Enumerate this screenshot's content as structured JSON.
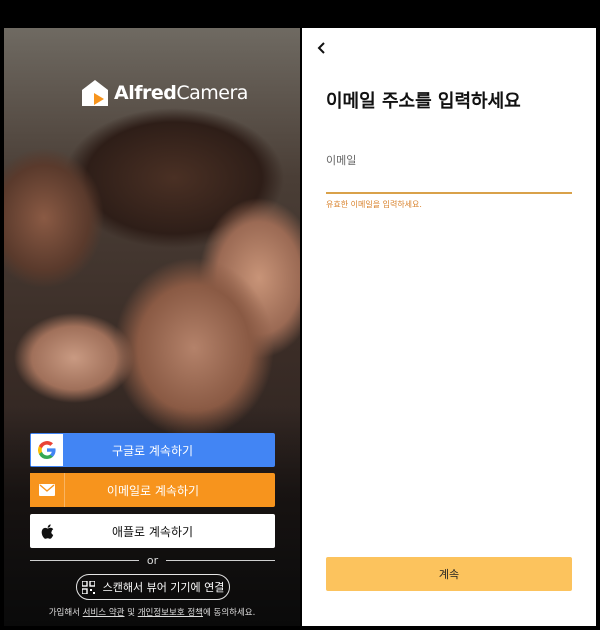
{
  "brand": {
    "name_bold": "Alfred",
    "name_regular": "Camera"
  },
  "left": {
    "buttons": {
      "google": "구글로 계속하기",
      "email": "이메일로 계속하기",
      "apple": "애플로 계속하기"
    },
    "or_text": "or",
    "scan_button": "스캔해서 뷰어 기기에 연결",
    "terms": {
      "prefix": "가입해서 ",
      "tos": "서비스 약관",
      "and": " 및 ",
      "privacy": "개인정보보호 정책",
      "suffix": "에 동의하세요."
    }
  },
  "right": {
    "title": "이메일 주소를 입력하세요",
    "email_label": "이메일",
    "email_value": "",
    "error": "유효한 이메일을 입력하세요.",
    "continue": "계속"
  },
  "colors": {
    "google": "#4285f4",
    "email": "#f7941d",
    "accent": "#fcc35d",
    "underline": "#d9a14a"
  }
}
